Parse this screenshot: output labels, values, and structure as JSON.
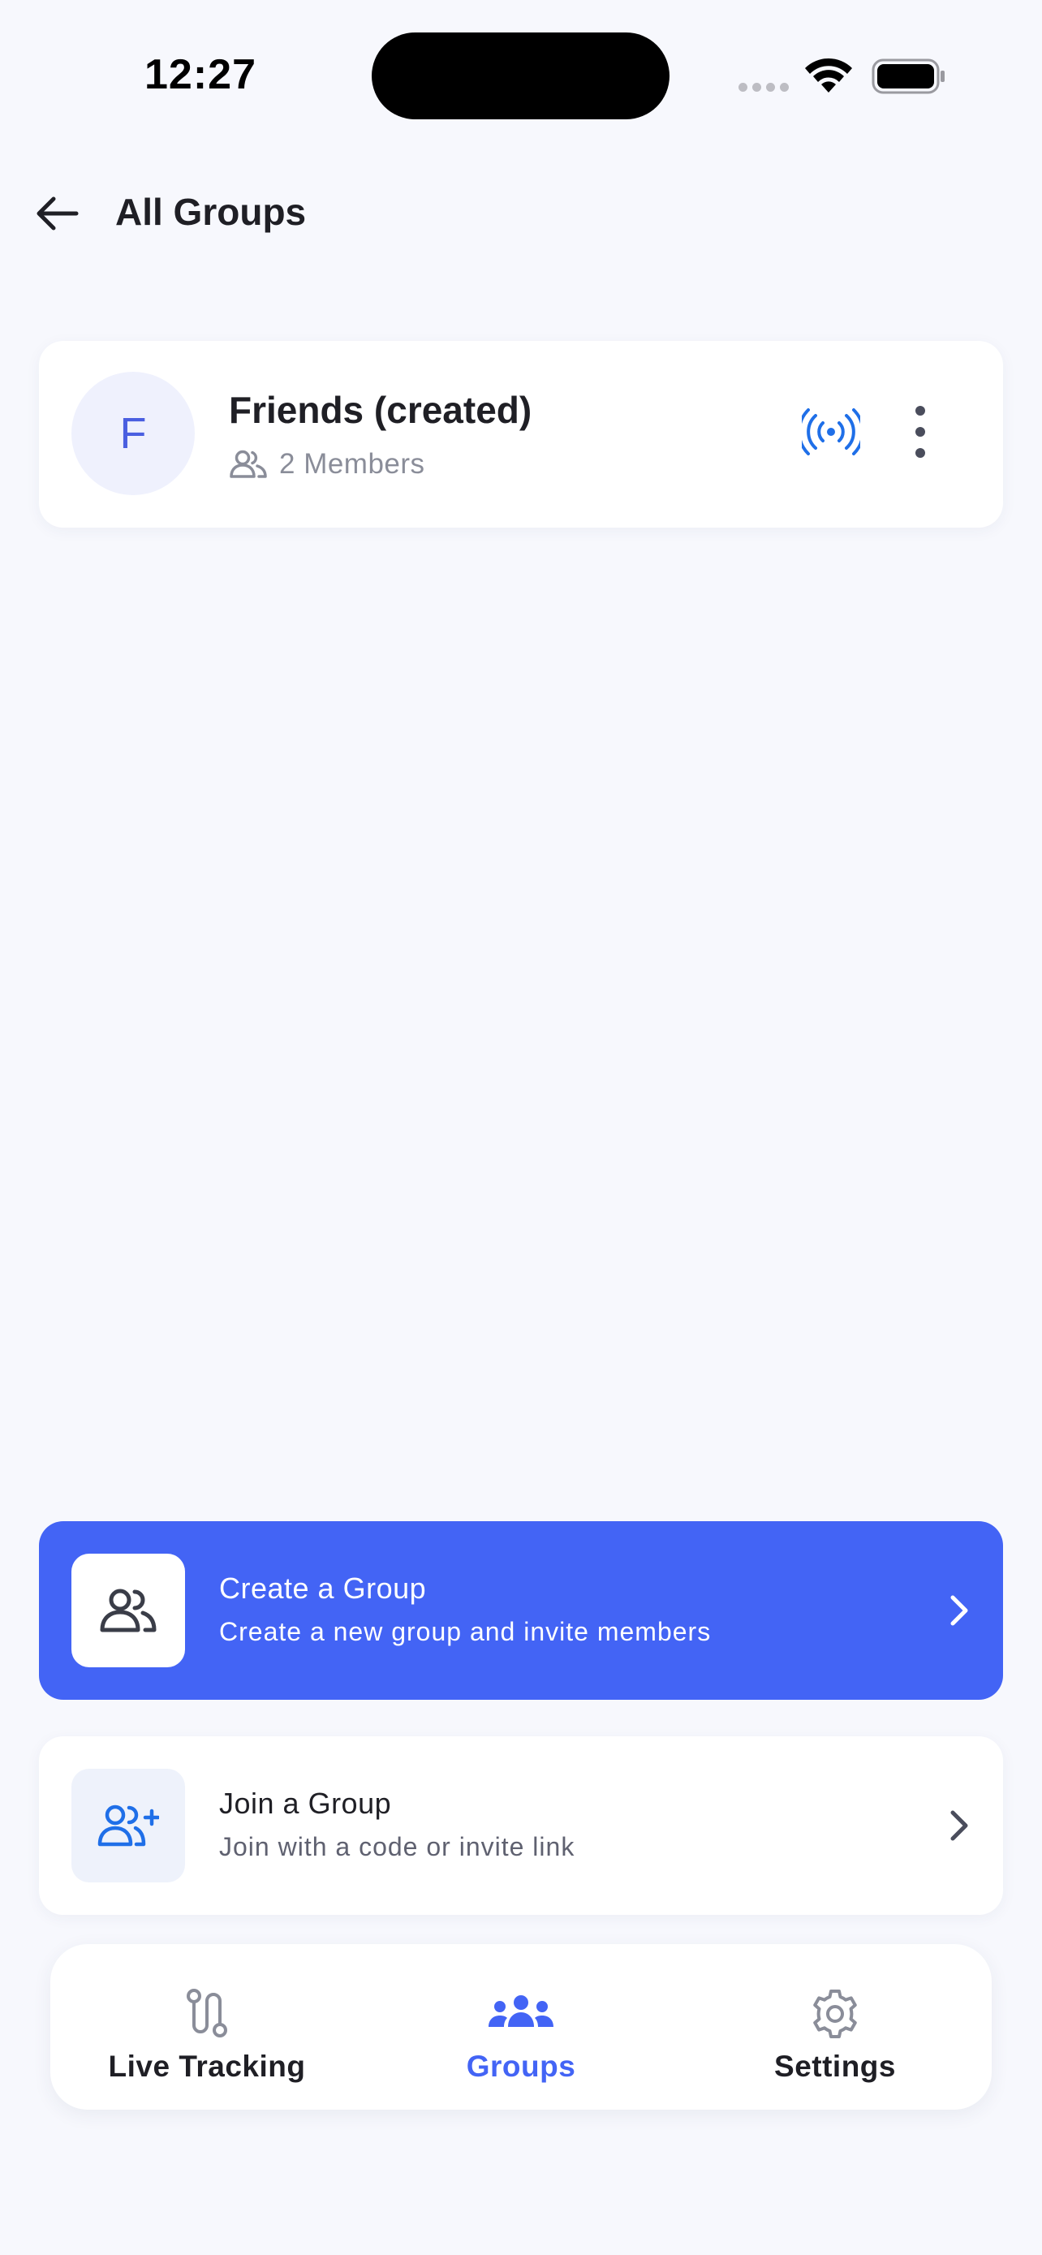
{
  "status_bar": {
    "time": "12:27"
  },
  "header": {
    "title": "All Groups"
  },
  "groups": [
    {
      "initial": "F",
      "name": "Friends (created)",
      "members": "2 Members"
    }
  ],
  "actions": {
    "create": {
      "title": "Create a Group",
      "subtitle": "Create a new group and invite members"
    },
    "join": {
      "title": "Join a Group",
      "subtitle": "Join with a code or invite link"
    }
  },
  "nav": {
    "items": [
      {
        "label": "Live Tracking",
        "icon": "route-icon",
        "active": false
      },
      {
        "label": "Groups",
        "icon": "groups-icon",
        "active": true
      },
      {
        "label": "Settings",
        "icon": "gear-icon",
        "active": false
      }
    ]
  },
  "colors": {
    "accent": "#4364F5",
    "background": "#F7F8FD",
    "live_icon": "#1F6FE8",
    "avatar_bg": "#EFF1FD"
  }
}
